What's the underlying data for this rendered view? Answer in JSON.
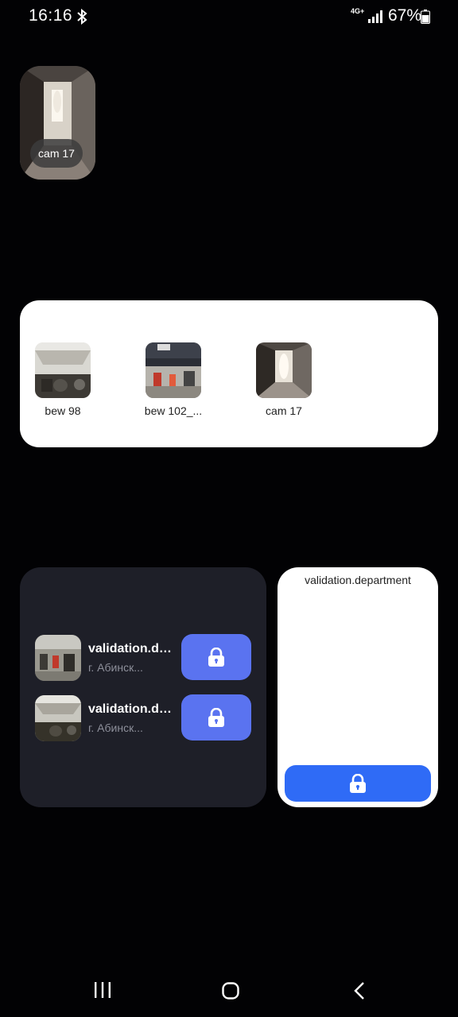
{
  "status_bar": {
    "time": "16:16",
    "network": "4G+",
    "battery": "67%"
  },
  "cam_widget": {
    "label": "cam 17"
  },
  "camera_list": {
    "items": [
      {
        "label": "bew 98"
      },
      {
        "label": "bew 102_..."
      },
      {
        "label": "cam 17"
      }
    ]
  },
  "locks_widget": {
    "rows": [
      {
        "name": "validation.de...",
        "address": "г. Абинск..."
      },
      {
        "name": "validation.de...",
        "address": "г. Абинск..."
      }
    ],
    "button_icon": "lock-icon",
    "button_color": "#5a73f0"
  },
  "single_lock_widget": {
    "title": "validation.department",
    "button_icon": "lock-icon",
    "button_color": "#2f6bf6"
  },
  "nav_bar": {
    "recent_icon": "recent-apps-icon",
    "home_icon": "home-icon",
    "back_icon": "back-icon"
  }
}
